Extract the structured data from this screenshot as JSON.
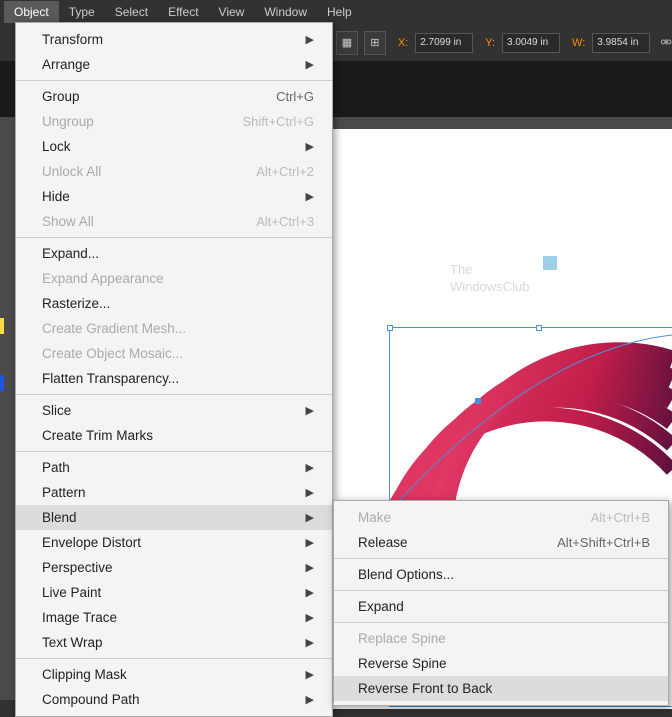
{
  "menubar": {
    "items": [
      "Object",
      "Type",
      "Select",
      "Effect",
      "View",
      "Window",
      "Help"
    ],
    "active_index": 0
  },
  "toolbar": {
    "x_label": "X:",
    "x_value": "2.7099 in",
    "y_label": "Y:",
    "y_value": "3.0049 in",
    "w_label": "W:",
    "w_value": "3.9854 in"
  },
  "watermark": {
    "line1": "The",
    "line2": "WindowsClub"
  },
  "object_menu": [
    {
      "label": "Transform",
      "arrow": true
    },
    {
      "label": "Arrange",
      "arrow": true
    },
    {
      "sep": true
    },
    {
      "label": "Group",
      "shortcut": "Ctrl+G"
    },
    {
      "label": "Ungroup",
      "shortcut": "Shift+Ctrl+G",
      "disabled": true
    },
    {
      "label": "Lock",
      "arrow": true
    },
    {
      "label": "Unlock All",
      "shortcut": "Alt+Ctrl+2",
      "disabled": true
    },
    {
      "label": "Hide",
      "arrow": true
    },
    {
      "label": "Show All",
      "shortcut": "Alt+Ctrl+3",
      "disabled": true
    },
    {
      "sep": true
    },
    {
      "label": "Expand..."
    },
    {
      "label": "Expand Appearance",
      "disabled": true
    },
    {
      "label": "Rasterize..."
    },
    {
      "label": "Create Gradient Mesh...",
      "disabled": true
    },
    {
      "label": "Create Object Mosaic...",
      "disabled": true
    },
    {
      "label": "Flatten Transparency..."
    },
    {
      "sep": true
    },
    {
      "label": "Slice",
      "arrow": true
    },
    {
      "label": "Create Trim Marks"
    },
    {
      "sep": true
    },
    {
      "label": "Path",
      "arrow": true
    },
    {
      "label": "Pattern",
      "arrow": true
    },
    {
      "label": "Blend",
      "arrow": true,
      "highlighted": true
    },
    {
      "label": "Envelope Distort",
      "arrow": true
    },
    {
      "label": "Perspective",
      "arrow": true
    },
    {
      "label": "Live Paint",
      "arrow": true
    },
    {
      "label": "Image Trace",
      "arrow": true
    },
    {
      "label": "Text Wrap",
      "arrow": true
    },
    {
      "sep": true
    },
    {
      "label": "Clipping Mask",
      "arrow": true
    },
    {
      "label": "Compound Path",
      "arrow": true
    }
  ],
  "blend_submenu": [
    {
      "label": "Make",
      "shortcut": "Alt+Ctrl+B",
      "disabled": true
    },
    {
      "label": "Release",
      "shortcut": "Alt+Shift+Ctrl+B"
    },
    {
      "sep": true
    },
    {
      "label": "Blend Options..."
    },
    {
      "sep": true
    },
    {
      "label": "Expand"
    },
    {
      "sep": true
    },
    {
      "label": "Replace Spine",
      "disabled": true
    },
    {
      "label": "Reverse Spine"
    },
    {
      "label": "Reverse Front to Back",
      "highlighted": true
    }
  ]
}
